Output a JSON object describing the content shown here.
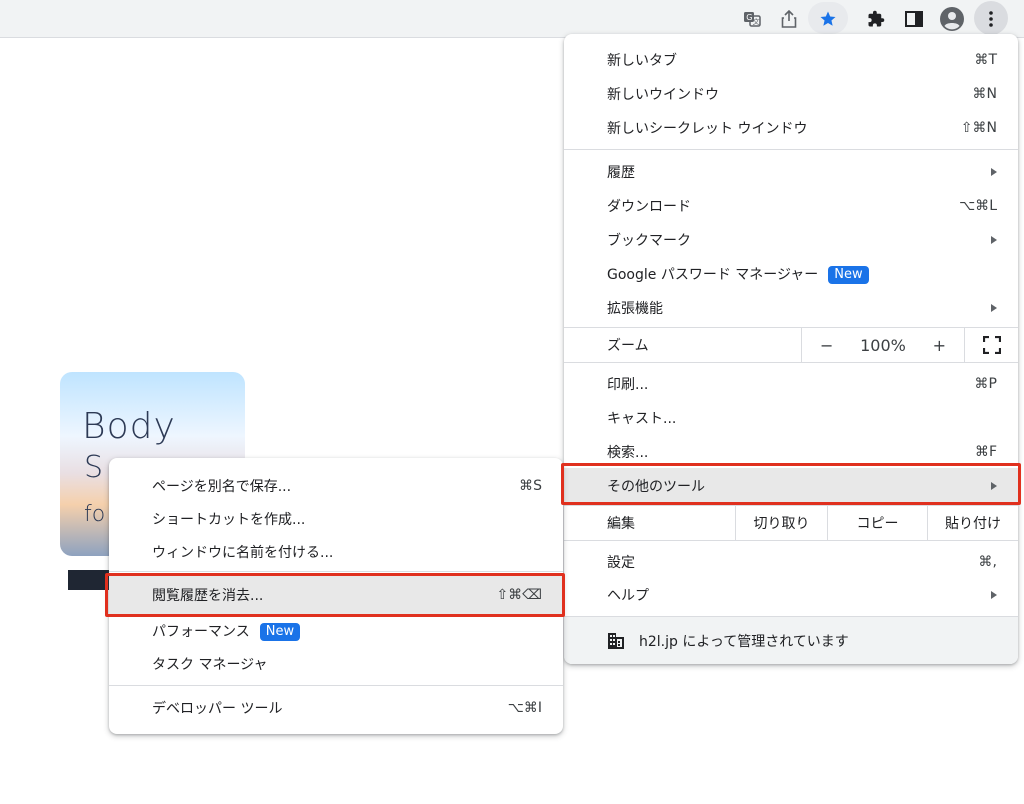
{
  "toolbar": {
    "icons": [
      "translate-icon",
      "share-icon",
      "bookmark-star-icon",
      "extensions-icon",
      "side-panel-icon",
      "profile-avatar-icon",
      "chrome-menu-icon"
    ],
    "star_color": "#1a73e8"
  },
  "page": {
    "thumbnail_title": "Body",
    "thumbnail_line2": "S",
    "thumbnail_line3": "fo"
  },
  "main_menu": {
    "new_tab": {
      "label": "新しいタブ",
      "shortcut": "⌘T"
    },
    "new_window": {
      "label": "新しいウインドウ",
      "shortcut": "⌘N"
    },
    "new_incognito": {
      "label": "新しいシークレット ウインドウ",
      "shortcut": "⇧⌘N"
    },
    "history": {
      "label": "履歴"
    },
    "downloads": {
      "label": "ダウンロード",
      "shortcut": "⌥⌘L"
    },
    "bookmarks": {
      "label": "ブックマーク"
    },
    "password_manager": {
      "label": "Google パスワード マネージャー",
      "badge": "New"
    },
    "extensions": {
      "label": "拡張機能"
    },
    "zoom": {
      "label": "ズーム",
      "minus": "−",
      "value": "100%",
      "plus": "+"
    },
    "print": {
      "label": "印刷...",
      "shortcut": "⌘P"
    },
    "cast": {
      "label": "キャスト..."
    },
    "find": {
      "label": "検索...",
      "shortcut": "⌘F"
    },
    "more_tools": {
      "label": "その他のツール"
    },
    "edit": {
      "label": "編集",
      "cut": "切り取り",
      "copy": "コピー",
      "paste": "貼り付け"
    },
    "settings": {
      "label": "設定",
      "shortcut": "⌘,"
    },
    "help": {
      "label": "ヘルプ"
    },
    "managed": {
      "label": "h2l.jp によって管理されています"
    }
  },
  "sub_menu": {
    "save_page": {
      "label": "ページを別名で保存...",
      "shortcut": "⌘S"
    },
    "create_shortcut": {
      "label": "ショートカットを作成..."
    },
    "name_window": {
      "label": "ウィンドウに名前を付ける..."
    },
    "clear_data": {
      "label": "閲覧履歴を消去...",
      "shortcut": "⇧⌘⌫"
    },
    "performance": {
      "label": "パフォーマンス",
      "badge": "New"
    },
    "task_manager": {
      "label": "タスク マネージャ"
    },
    "dev_tools": {
      "label": "デベロッパー ツール",
      "shortcut": "⌥⌘I"
    }
  },
  "colors": {
    "highlight_border": "#e0301e",
    "badge": "#1a73e8"
  }
}
